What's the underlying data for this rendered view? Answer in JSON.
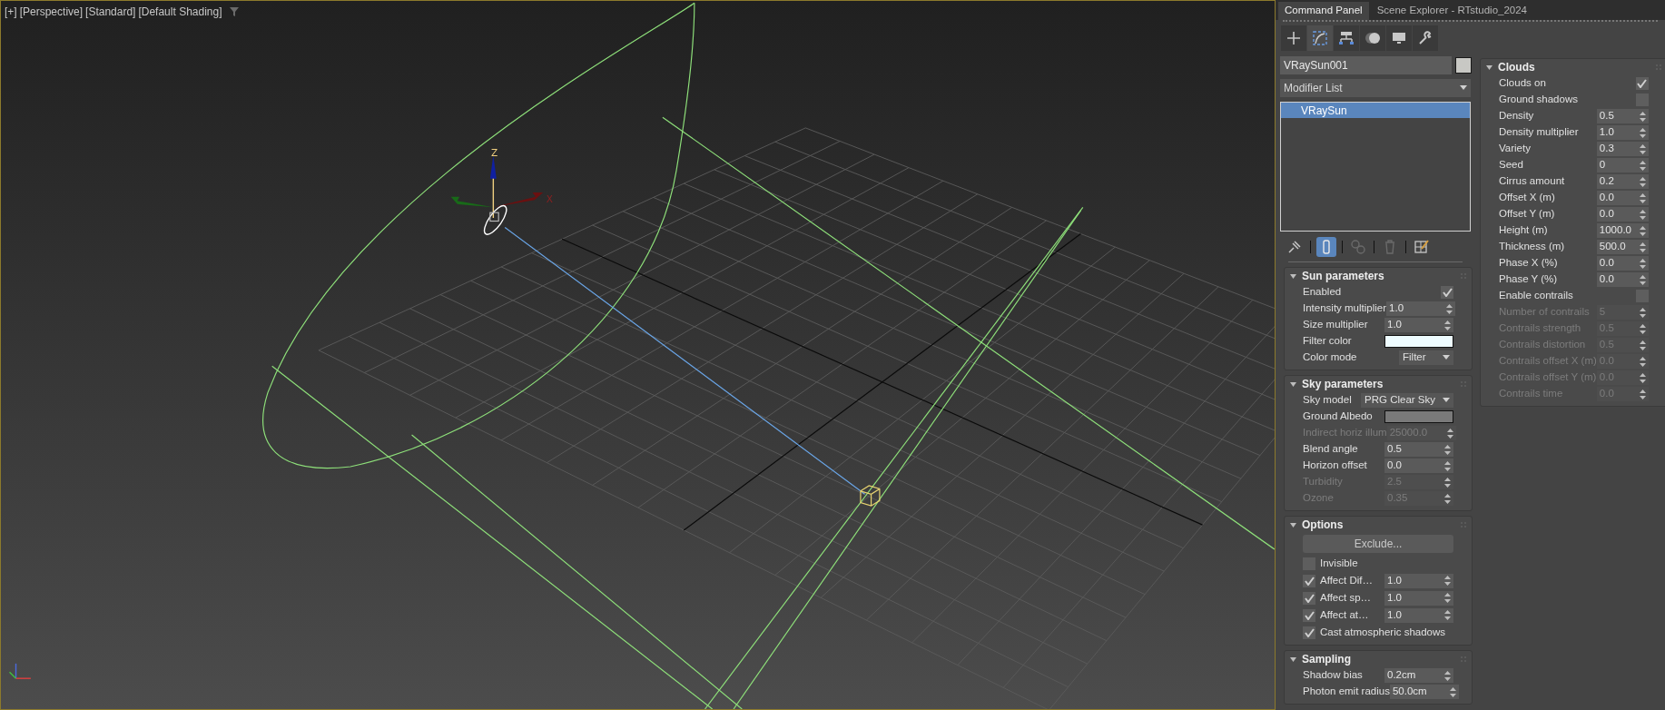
{
  "viewport": {
    "labels": [
      "[+]",
      "[Perspective]",
      "[Standard]",
      "[Default Shading]"
    ],
    "gizmo_labels": [
      "Z",
      "X"
    ]
  },
  "panel_tabs": [
    {
      "label": "Command Panel",
      "selected": true
    },
    {
      "label": "Scene Explorer - RTstudio_2024",
      "selected": false
    }
  ],
  "command_tabs": [
    {
      "kind": "create",
      "selected": false
    },
    {
      "kind": "modify",
      "selected": true
    },
    {
      "kind": "hierarchy",
      "selected": false
    },
    {
      "kind": "motion",
      "selected": false
    },
    {
      "kind": "display",
      "selected": false
    },
    {
      "kind": "utilities",
      "selected": false
    }
  ],
  "object": {
    "name": "VRaySun001",
    "color": "#c8c8c4"
  },
  "modifier_list": {
    "label": "Modifier List"
  },
  "stack": [
    {
      "label": "VRaySun",
      "selected": true
    }
  ],
  "stack_tools": [
    {
      "kind": "pin",
      "selected": false
    },
    {
      "kind": "end-result",
      "selected": true
    },
    {
      "kind": "unique",
      "selected": false
    },
    {
      "kind": "remove",
      "selected": false
    },
    {
      "kind": "configure",
      "selected": false
    }
  ],
  "rollouts": [
    {
      "title": "Sun parameters",
      "rows": [
        {
          "kind": "toggle",
          "label": "Enabled",
          "checked": true
        },
        {
          "kind": "spinner",
          "label": "Intensity multiplier",
          "value": "1.0",
          "disabled": false
        },
        {
          "kind": "spinner",
          "label": "Size multiplier",
          "value": "1.0",
          "disabled": false
        },
        {
          "kind": "color",
          "label": "Filter color",
          "color": "#eefcff"
        },
        {
          "kind": "dropdown",
          "label": "Color mode",
          "value": "Filter"
        }
      ]
    },
    {
      "title": "Sky parameters",
      "rows": [
        {
          "kind": "dropdown",
          "label": "Sky model",
          "value": "PRG Clear Sky"
        },
        {
          "kind": "color",
          "label": "Ground Albedo",
          "color": "#7a7a7a"
        },
        {
          "kind": "spinner",
          "label": "Indirect horiz illum",
          "value": "25000.0",
          "disabled": true
        },
        {
          "kind": "spinner",
          "label": "Blend angle",
          "value": "0.5",
          "disabled": false
        },
        {
          "kind": "spinner",
          "label": "Horizon offset",
          "value": "0.0",
          "disabled": false
        },
        {
          "kind": "spinner",
          "label": "Turbidity",
          "value": "2.5",
          "disabled": true
        },
        {
          "kind": "spinner",
          "label": "Ozone",
          "value": "0.35",
          "disabled": true
        }
      ]
    },
    {
      "title": "Options",
      "rows": [
        {
          "kind": "button",
          "label": "Exclude..."
        },
        {
          "kind": "check",
          "label": "Invisible",
          "checked": false
        },
        {
          "kind": "checkspinner",
          "label": "Affect Dif…",
          "checked": true,
          "value": "1.0"
        },
        {
          "kind": "checkspinner",
          "label": "Affect sp…",
          "checked": true,
          "value": "1.0"
        },
        {
          "kind": "checkspinner",
          "label": "Affect at…",
          "checked": true,
          "value": "1.0"
        },
        {
          "kind": "check",
          "label": "Cast atmospheric shadows",
          "checked": true
        }
      ]
    },
    {
      "title": "Sampling",
      "rows": [
        {
          "kind": "spinner",
          "label": "Shadow bias",
          "value": "0.2cm",
          "disabled": false
        },
        {
          "kind": "spinner",
          "label": "Photon emit radius",
          "value": "50.0cm",
          "disabled": false
        }
      ]
    }
  ],
  "side_rollouts": [
    {
      "title": "Clouds",
      "rows": [
        {
          "kind": "toggle",
          "label": "Clouds on",
          "checked": true
        },
        {
          "kind": "toggle",
          "label": "Ground shadows",
          "checked": false
        },
        {
          "kind": "spinner",
          "label": "Density",
          "value": "0.5",
          "disabled": false
        },
        {
          "kind": "spinner",
          "label": "Density multiplier",
          "value": "1.0",
          "disabled": false
        },
        {
          "kind": "spinner",
          "label": "Variety",
          "value": "0.3",
          "disabled": false
        },
        {
          "kind": "spinner",
          "label": "Seed",
          "value": "0",
          "disabled": false
        },
        {
          "kind": "spinner",
          "label": "Cirrus amount",
          "value": "0.2",
          "disabled": false
        },
        {
          "kind": "spinner",
          "label": "Offset X (m)",
          "value": "0.0",
          "disabled": false
        },
        {
          "kind": "spinner",
          "label": "Offset Y (m)",
          "value": "0.0",
          "disabled": false
        },
        {
          "kind": "spinner",
          "label": "Height (m)",
          "value": "1000.0",
          "disabled": false
        },
        {
          "kind": "spinner",
          "label": "Thickness (m)",
          "value": "500.0",
          "disabled": false
        },
        {
          "kind": "spinner",
          "label": "Phase X (%)",
          "value": "0.0",
          "disabled": false
        },
        {
          "kind": "spinner",
          "label": "Phase Y (%)",
          "value": "0.0",
          "disabled": false
        },
        {
          "kind": "toggle",
          "label": "Enable contrails",
          "checked": false
        },
        {
          "kind": "spinner",
          "label": "Number of contrails",
          "value": "5",
          "disabled": true
        },
        {
          "kind": "spinner",
          "label": "Contrails strength",
          "value": "0.5",
          "disabled": true
        },
        {
          "kind": "spinner",
          "label": "Contrails distortion",
          "value": "0.5",
          "disabled": true
        },
        {
          "kind": "spinner",
          "label": "Contrails offset X (m)",
          "value": "0.0",
          "disabled": true
        },
        {
          "kind": "spinner",
          "label": "Contrails offset Y (m)",
          "value": "0.0",
          "disabled": true
        },
        {
          "kind": "spinner",
          "label": "Contrails time",
          "value": "0.0",
          "disabled": true
        }
      ]
    }
  ]
}
